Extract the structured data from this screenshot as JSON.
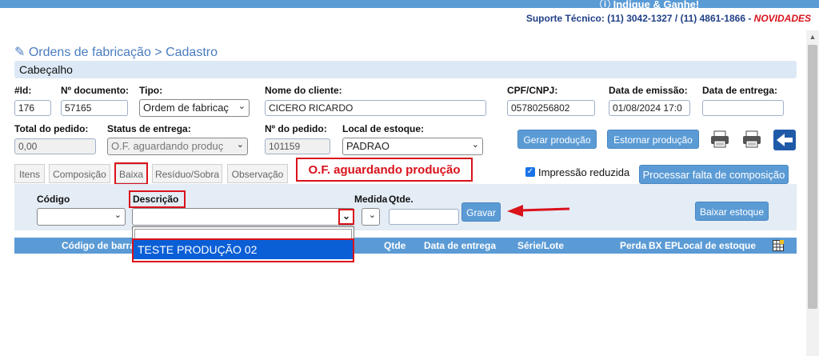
{
  "topbar": {
    "text": "Indique & Ganhe!"
  },
  "support": {
    "label": "Suporte Técnico: (11) 3042-1327 / (11) 4861-1866 - ",
    "novidades": "NOVIDADES"
  },
  "page": {
    "title": "Ordens de fabricação > Cadastro",
    "section": "Cabeçalho"
  },
  "header": {
    "id_label": "#Id:",
    "id_value": "176",
    "doc_label": "Nº documento:",
    "doc_value": "57165",
    "tipo_label": "Tipo:",
    "tipo_value": "Ordem de fabricaç",
    "cliente_label": "Nome do cliente:",
    "cliente_value": "CICERO RICARDO",
    "cpf_label": "CPF/CNPJ:",
    "cpf_value": "05780256802",
    "emissao_label": "Data de emissão:",
    "emissao_value": "01/08/2024 17:0",
    "entrega_label": "Data de entrega:",
    "entrega_value": "",
    "total_label": "Total do pedido:",
    "total_value": "0,00",
    "status_label": "Status de entrega:",
    "status_value": "O.F. aguardando produç",
    "pedido_label": "Nº do pedido:",
    "pedido_value": "101159",
    "estoque_label": "Local de estoque:",
    "estoque_value": "PADRAO"
  },
  "actions": {
    "gerar": "Gerar produção",
    "estornar": "Estornar produção",
    "processar": "Processar falta de composição"
  },
  "tabs": [
    "Itens",
    "Composição",
    "Baixa",
    "Resíduo/Sobra",
    "Observação"
  ],
  "status_banner": "O.F. aguardando produção",
  "impressao": {
    "label": "Impressão reduzida",
    "checked": true
  },
  "baixa": {
    "codigo_label": "Código",
    "descricao_label": "Descrição",
    "medida_label": "Medida",
    "qtde_label": "Qtde.",
    "gravar": "Gravar",
    "baixar_estoque": "Baixar estoque",
    "dropdown_option": "TESTE PRODUÇÃO 02"
  },
  "grid": {
    "columns": [
      "Código de barra",
      "Qtde",
      "Data de entrega",
      "Série/Lote",
      "Perda",
      "BX EP",
      "Local de estoque"
    ]
  },
  "colors": {
    "accent": "#5b9bd5",
    "highlight": "#d9121b",
    "selected": "#0b5fd6"
  }
}
